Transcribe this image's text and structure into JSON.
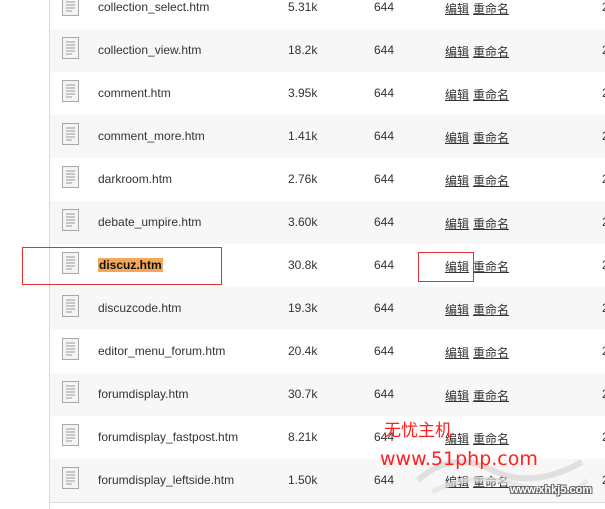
{
  "files": [
    {
      "name": "collection_select.htm",
      "size": "5.31k",
      "perm": "644",
      "edit": "编辑",
      "rename": "重命名",
      "tail": "2"
    },
    {
      "name": "collection_view.htm",
      "size": "18.2k",
      "perm": "644",
      "edit": "编辑",
      "rename": "重命名",
      "tail": "2"
    },
    {
      "name": "comment.htm",
      "size": "3.95k",
      "perm": "644",
      "edit": "编辑",
      "rename": "重命名",
      "tail": "2"
    },
    {
      "name": "comment_more.htm",
      "size": "1.41k",
      "perm": "644",
      "edit": "编辑",
      "rename": "重命名",
      "tail": "2"
    },
    {
      "name": "darkroom.htm",
      "size": "2.76k",
      "perm": "644",
      "edit": "编辑",
      "rename": "重命名",
      "tail": "2"
    },
    {
      "name": "debate_umpire.htm",
      "size": "3.60k",
      "perm": "644",
      "edit": "编辑",
      "rename": "重命名",
      "tail": "2"
    },
    {
      "name": "discuz.htm",
      "size": "30.8k",
      "perm": "644",
      "edit": "编辑",
      "rename": "重命名",
      "tail": "2"
    },
    {
      "name": "discuzcode.htm",
      "size": "19.3k",
      "perm": "644",
      "edit": "编辑",
      "rename": "重命名",
      "tail": "2"
    },
    {
      "name": "editor_menu_forum.htm",
      "size": "20.4k",
      "perm": "644",
      "edit": "编辑",
      "rename": "重命名",
      "tail": "2"
    },
    {
      "name": "forumdisplay.htm",
      "size": "30.7k",
      "perm": "644",
      "edit": "编辑",
      "rename": "重命名",
      "tail": "2"
    },
    {
      "name": "forumdisplay_fastpost.htm",
      "size": "8.21k",
      "perm": "644",
      "edit": "编辑",
      "rename": "重命名",
      "tail": "2"
    },
    {
      "name": "forumdisplay_leftside.htm",
      "size": "1.50k",
      "perm": "644",
      "edit": "编辑",
      "rename": "重命名",
      "tail": "2"
    }
  ],
  "selected_file": "discuz.htm",
  "watermark": {
    "line1": "无忧主机",
    "line2": "www.51php.com",
    "line3": "www.xhkj5.com"
  },
  "colors": {
    "selection": "#f2a75a",
    "highlight_box": "#e03030",
    "watermark": "#ff1f1f"
  }
}
